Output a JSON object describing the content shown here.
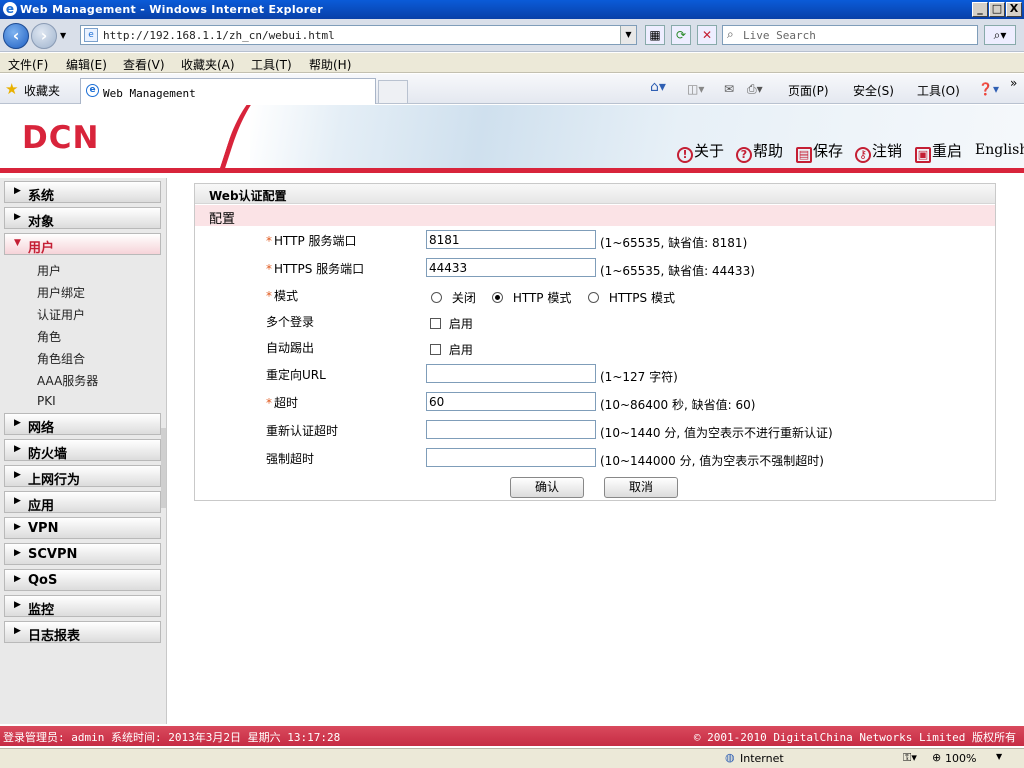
{
  "window": {
    "title": "Web Management - Windows Internet Explorer",
    "min": "_",
    "max": "□",
    "close": "X"
  },
  "address": {
    "url": "http://192.168.1.1/zh_cn/webui.html",
    "search_placeholder": "Live Search"
  },
  "menu": [
    "文件(F)",
    "编辑(E)",
    "查看(V)",
    "收藏夹(A)",
    "工具(T)",
    "帮助(H)"
  ],
  "favorites": {
    "label": "收藏夹",
    "tab_title": "Web Management"
  },
  "commandbar": {
    "page": "页面(P)",
    "safety": "安全(S)",
    "tools": "工具(O)"
  },
  "brand": {
    "logo": "DCN",
    "color": "#d8243b"
  },
  "header_actions": [
    {
      "icon": "info-icon",
      "label": "关于"
    },
    {
      "icon": "help-icon",
      "label": "帮助"
    },
    {
      "icon": "save-icon",
      "label": "保存"
    },
    {
      "icon": "key-icon",
      "label": "注销"
    },
    {
      "icon": "restart-icon",
      "label": "重启"
    },
    {
      "icon": "",
      "label": "English"
    }
  ],
  "sidebar": {
    "sections": [
      "系统",
      "对象",
      "用户",
      "网络",
      "防火墙",
      "上网行为",
      "应用",
      "VPN",
      "SCVPN",
      "QoS",
      "监控",
      "日志报表"
    ],
    "active": "用户",
    "sub_items": [
      "用户",
      "用户绑定",
      "认证用户",
      "角色",
      "角色组合",
      "AAA服务器",
      "PKI"
    ]
  },
  "panel": {
    "title": "Web认证配置",
    "section": "配置",
    "fields": {
      "http_port": {
        "label": "HTTP 服务端口",
        "value": "8181",
        "hint": "(1~65535, 缺省值: 8181)"
      },
      "https_port": {
        "label": "HTTPS 服务端口",
        "value": "44433",
        "hint": "(1~65535, 缺省值: 44433)"
      },
      "mode": {
        "label": "模式",
        "options": [
          "关闭",
          "HTTP 模式",
          "HTTPS 模式"
        ],
        "selected": "HTTP 模式"
      },
      "multi_login": {
        "label": "多个登录",
        "option": "启用"
      },
      "auto_kick": {
        "label": "自动踢出",
        "option": "启用"
      },
      "redirect_url": {
        "label": "重定向URL",
        "value": "",
        "hint": "(1~127 字符)"
      },
      "timeout": {
        "label": "超时",
        "value": "60",
        "hint": "(10~86400 秒, 缺省值: 60)"
      },
      "reauth_timeout": {
        "label": "重新认证超时",
        "value": "",
        "hint": "(10~1440 分, 值为空表示不进行重新认证)"
      },
      "force_timeout": {
        "label": "强制超时",
        "value": "",
        "hint": "(10~144000 分, 值为空表示不强制超时)"
      }
    },
    "ok_label": "确认",
    "cancel_label": "取消"
  },
  "footer": {
    "left": "登录管理员: admin 系统时间: 2013年3月2日 星期六 13:17:28",
    "right": "© 2001-2010 DigitalChina Networks Limited 版权所有"
  },
  "statusbar": {
    "zone": "Internet",
    "zoom": "100%"
  }
}
